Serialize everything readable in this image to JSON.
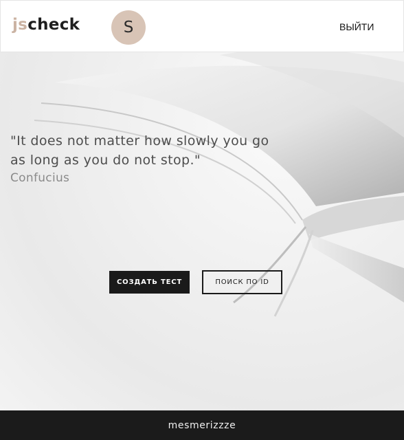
{
  "header": {
    "logo_prefix": "js",
    "logo_suffix": "check",
    "avatar_initial": "S",
    "logout_label": "ВЫЙТИ"
  },
  "hero": {
    "quote_text": "\"It does not matter how slowly you go as long as you do not stop.\"",
    "quote_author": "Confucius",
    "create_test_label": "СОЗДАТЬ ТЕСТ",
    "search_by_id_label": "ПОИСК ПО ID"
  },
  "footer": {
    "text": "mesmerizzze"
  },
  "colors": {
    "logo_accent": "#cbb3a3",
    "avatar_bg": "#d8c4b6",
    "dark": "#1a1a1a"
  }
}
